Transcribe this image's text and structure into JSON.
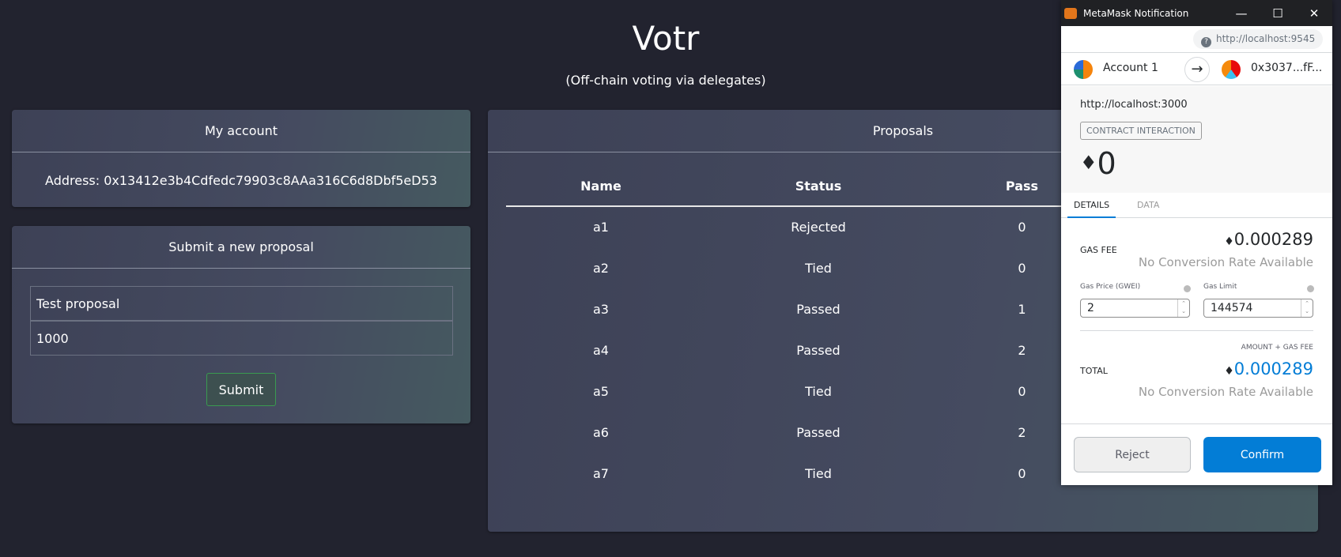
{
  "app": {
    "title": "Votr",
    "subtitle": "(Off-chain voting via delegates)"
  },
  "account": {
    "heading": "My account",
    "address": "Address: 0x13412e3b4Cdfedc79903c8AAa316C6d8Dbf5eD53"
  },
  "submit": {
    "heading": "Submit a new proposal",
    "name_value": "Test proposal",
    "amount_value": "1000",
    "button": "Submit"
  },
  "proposals": {
    "heading": "Proposals",
    "columns": [
      "Name",
      "Status",
      "Pass"
    ],
    "rows": [
      [
        "a1",
        "Rejected",
        "0"
      ],
      [
        "a2",
        "Tied",
        "0"
      ],
      [
        "a3",
        "Passed",
        "1"
      ],
      [
        "a4",
        "Passed",
        "2"
      ],
      [
        "a5",
        "Tied",
        "0"
      ],
      [
        "a6",
        "Passed",
        "2"
      ],
      [
        "a7",
        "Tied",
        "0"
      ]
    ]
  },
  "metamask": {
    "window_title": "MetaMask Notification",
    "network": "http://localhost:9545",
    "from": "Account 1",
    "to": "0x3037...fF...",
    "origin": "http://localhost:3000",
    "badge": "CONTRACT INTERACTION",
    "amount": "0",
    "tabs": [
      "DETAILS",
      "DATA"
    ],
    "gas_fee_label": "GAS FEE",
    "gas_fee": "0.000289",
    "no_rate": "No Conversion Rate Available",
    "gas_price_label": "Gas Price (GWEI)",
    "gas_price": "2",
    "gas_limit_label": "Gas Limit",
    "gas_limit": "144574",
    "amount_gas_label": "AMOUNT + GAS FEE",
    "total_label": "TOTAL",
    "total": "0.000289",
    "reject": "Reject",
    "confirm": "Confirm",
    "accent": "#037dd6"
  }
}
